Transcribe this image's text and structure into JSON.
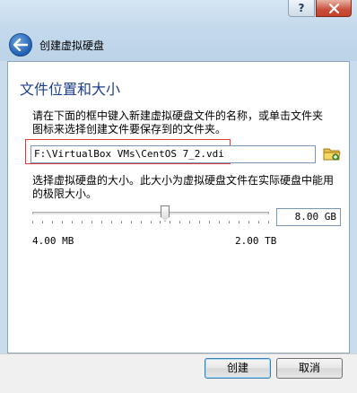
{
  "window": {
    "help_label": "?",
    "icons": {
      "help": "help-icon",
      "close": "close-icon",
      "back": "back-arrow-icon",
      "folder": "folder-icon"
    },
    "close_color": "#c5412b"
  },
  "header": {
    "title": "创建虚拟硬盘"
  },
  "section": {
    "title": "文件位置和大小"
  },
  "location": {
    "description": "请在下面的框中键入新建虚拟硬盘文件的名称，或单击文件夹图标来选择创建文件要保存到的文件夹。",
    "path_value": "F:\\VirtualBox VMs\\CentOS 7_2.vdi"
  },
  "size": {
    "description": "选择虚拟硬盘的大小。此大小为虚拟硬盘文件在实际硬盘中能用的极限大小。",
    "value": "8.00 GB",
    "min_label": "4.00 MB",
    "max_label": "2.00 TB",
    "slider_fraction": 0.56
  },
  "buttons": {
    "create_label": "创建",
    "cancel_label": "取消"
  }
}
